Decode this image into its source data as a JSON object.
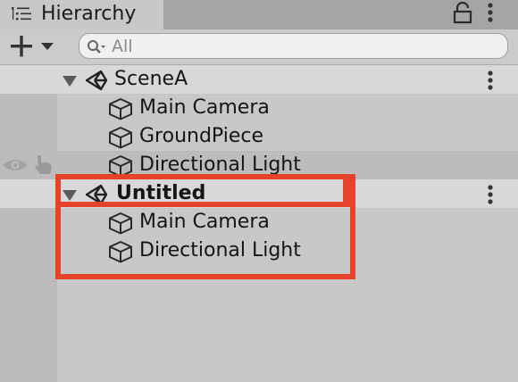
{
  "window": {
    "tab_title": "Hierarchy",
    "tab_icon": "hierarchy-list-icon",
    "lock_icon": "lock-icon",
    "menu_icon": "kebab-menu-icon"
  },
  "toolbar": {
    "create_button_icon": "plus-dropdown-icon",
    "search": {
      "placeholder": "All",
      "value": ""
    }
  },
  "scenes": [
    {
      "name": "SceneA",
      "bold": false,
      "expanded": true,
      "items": [
        {
          "label": "Main Camera",
          "icon": "gameobject-cube-icon"
        },
        {
          "label": "GroundPiece",
          "icon": "gameobject-cube-icon"
        },
        {
          "label": "Directional Light",
          "icon": "gameobject-cube-icon",
          "hovered": true
        }
      ]
    },
    {
      "name": "Untitled",
      "bold": true,
      "expanded": true,
      "items": [
        {
          "label": "Main Camera",
          "icon": "gameobject-cube-icon"
        },
        {
          "label": "Directional Light",
          "icon": "gameobject-cube-icon"
        }
      ]
    }
  ],
  "row_toggles": {
    "visibility_icon": "eye-icon",
    "pickability_icon": "hand-pointer-icon"
  },
  "colors": {
    "highlight": "#e8422a",
    "panel_bg": "#c8c8c8",
    "scene_header_bg": "#d8d8d8",
    "gutter_bg": "#bcbcbc"
  }
}
